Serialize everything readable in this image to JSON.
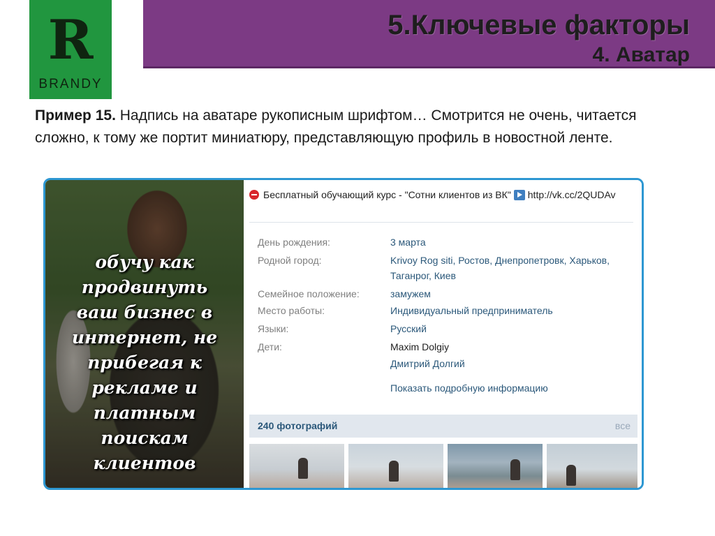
{
  "slide": {
    "title": "5.Ключевые факторы",
    "subtitle": "4. Аватар",
    "logo": {
      "letter": "R",
      "word": "BRANDY"
    },
    "colors": {
      "header": "#7c3a84",
      "logo": "#21963f",
      "frame": "#2d97d2"
    }
  },
  "body": {
    "example_label": "Пример 15.",
    "text": " Надпись на аватаре рукописным шрифтом… Смотрится не очень, читается сложно, к тому же портит миниатюру, представляющую профиль в новостной ленте."
  },
  "avatar": {
    "caption_lines": [
      "обучу как",
      "продвинуть",
      "ваш бизнес в",
      "интернет, не",
      "прибегая к",
      "рекламе и",
      "платным",
      "поискам",
      "клиентов"
    ]
  },
  "profile": {
    "status_prefix": "Бесплатный обучающий курс - \"Сотни клиентов из ВК\"",
    "status_link": "http://vk.cc/2QUDAv",
    "rows": [
      {
        "label": "День рождения:",
        "value": "3 марта"
      },
      {
        "label": "Родной город:",
        "value": "Krivoy Rog siti, Ростов, Днепропетровк, Харьков, Таганрог, Киев"
      },
      {
        "label": "Семейное положение:",
        "value": "замужем"
      },
      {
        "label": "Место работы:",
        "value": "Индивидуальный предприниматель"
      },
      {
        "label": "Языки:",
        "value": "Русский"
      },
      {
        "label": "Дети:",
        "value": "Maxim Dolgiy",
        "value2": "Дмитрий Долгий"
      }
    ],
    "more_link": "Показать подробную информацию",
    "photos_title": "240 фотографий",
    "photos_all": "все"
  },
  "icons": {
    "status": "stop-icon",
    "link": "play-icon"
  }
}
